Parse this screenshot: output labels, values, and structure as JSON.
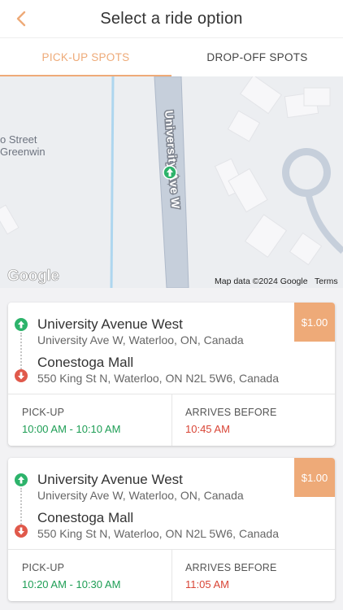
{
  "header": {
    "title": "Select a ride option",
    "back_icon": "chevron-left-icon",
    "accent": "#eeaa78"
  },
  "tabs": [
    {
      "label": "PICK-UP SPOTS",
      "active": true
    },
    {
      "label": "DROP-OFF SPOTS",
      "active": false
    }
  ],
  "map": {
    "road_label": "University Ave W",
    "street_label_1": "o Street",
    "street_label_2": "Greenwin",
    "logo": "Google",
    "attribution": "Map data ©2024 Google",
    "terms": "Terms",
    "marker_icon": "pickup-marker-icon"
  },
  "rides": [
    {
      "price": "$1.00",
      "pickup": {
        "name": "University Avenue West",
        "address": "University Ave W, Waterloo, ON, Canada"
      },
      "dropoff": {
        "name": "Conestoga Mall",
        "address": "550 King St N, Waterloo, ON N2L 5W6, Canada"
      },
      "pickup_label": "PICK-UP",
      "pickup_time": "10:00 AM - 10:10 AM",
      "arrives_label": "ARRIVES BEFORE",
      "arrives_time": "10:45 AM"
    },
    {
      "price": "$1.00",
      "pickup": {
        "name": "University Avenue West",
        "address": "University Ave W, Waterloo, ON, Canada"
      },
      "dropoff": {
        "name": "Conestoga Mall",
        "address": "550 King St N, Waterloo, ON N2L 5W6, Canada"
      },
      "pickup_label": "PICK-UP",
      "pickup_time": "10:20 AM - 10:30 AM",
      "arrives_label": "ARRIVES BEFORE",
      "arrives_time": "11:05 AM"
    }
  ]
}
